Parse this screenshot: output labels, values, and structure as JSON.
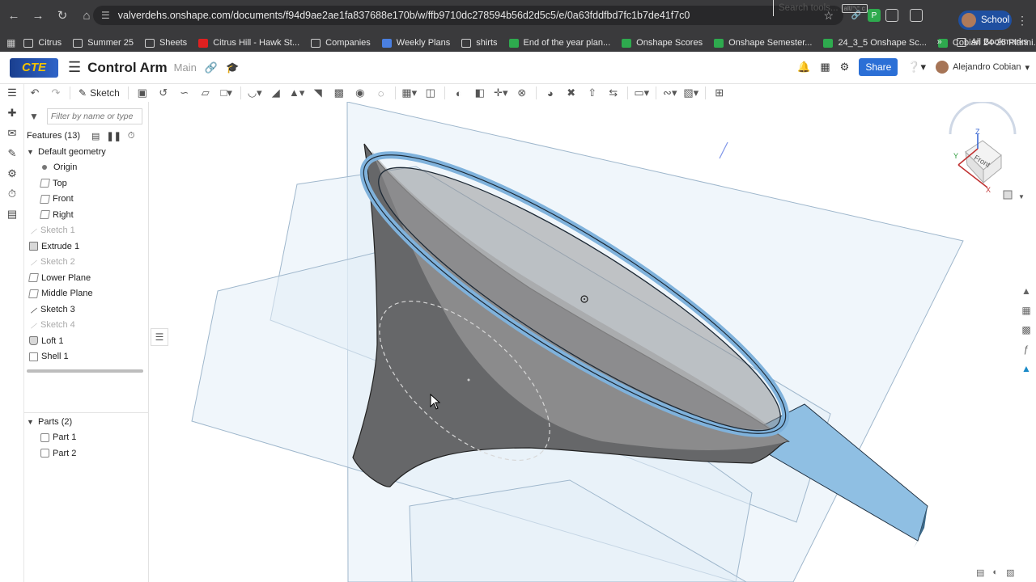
{
  "browser": {
    "url": "valverdehs.onshape.com/documents/f94d9ae2ae1fa837688e170b/w/ffb9710dc278594b56d2d5c5/e/0a63fddfbd7fc1b7de41f7c0",
    "profile_label": "School",
    "bookmarks": [
      "Citrus",
      "Summer 25",
      "Sheets",
      "Citrus Hill - Hawk St...",
      "Companies",
      "Weekly Plans",
      "shirts",
      "End of the year plan...",
      "Onshape Scores",
      "Onshape  Semester...",
      "24_3_5 Onshape Sc...",
      "Cobian 24-25 Planni..."
    ],
    "all_bookmarks": "All Bookmarks"
  },
  "header": {
    "logo_text": "CTE",
    "title": "Control Arm",
    "branch": "Main",
    "share_label": "Share",
    "user_name": "Alejandro Cobian"
  },
  "toolbar": {
    "sketch_label": "Sketch",
    "search_label": "Search tools...",
    "search_shortcut": "alt/⌥ c"
  },
  "panel": {
    "filter_placeholder": "Filter by name or type",
    "features_label": "Features (13)",
    "features": [
      {
        "label": "Default geometry",
        "type": "group"
      },
      {
        "label": "Origin",
        "type": "origin"
      },
      {
        "label": "Top",
        "type": "plane"
      },
      {
        "label": "Front",
        "type": "plane"
      },
      {
        "label": "Right",
        "type": "plane"
      },
      {
        "label": "Sketch 1",
        "type": "sketch",
        "dim": true
      },
      {
        "label": "Extrude 1",
        "type": "extrude"
      },
      {
        "label": "Sketch 2",
        "type": "sketch",
        "dim": true
      },
      {
        "label": "Lower Plane",
        "type": "plane"
      },
      {
        "label": "Middle Plane",
        "type": "plane"
      },
      {
        "label": "Sketch 3",
        "type": "sketch"
      },
      {
        "label": "Sketch 4",
        "type": "sketch",
        "dim": true
      },
      {
        "label": "Loft 1",
        "type": "loft"
      },
      {
        "label": "Shell 1",
        "type": "shell"
      }
    ],
    "parts_label": "Parts (2)",
    "parts": [
      "Part 1",
      "Part 2"
    ]
  },
  "viewcube": {
    "face_label": "Front",
    "axis_x": "X",
    "axis_y": "Y",
    "axis_z": "Z"
  },
  "colors": {
    "accent": "#2b6fd6",
    "plane_fill": "#dce9f4",
    "part_blue": "#9ec9ea",
    "funnel_dark": "#5d5e60"
  }
}
